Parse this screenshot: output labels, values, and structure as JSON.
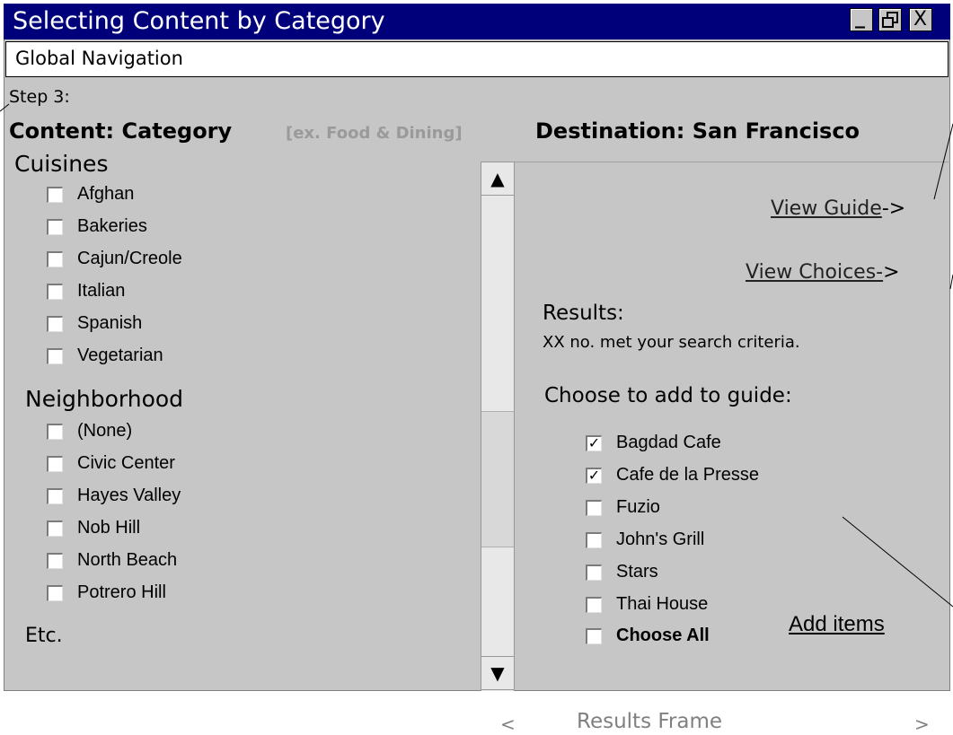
{
  "window": {
    "title": "Selecting Content by Category",
    "controls": {
      "minimize": "_",
      "restore": "❐",
      "close": "X"
    }
  },
  "global_nav": "Global Navigation",
  "step": "Step 3:",
  "content_category": {
    "label": "Content: Category",
    "example": "[ex. Food & Dining]"
  },
  "destination": "Destination: San Francisco",
  "left_panel": {
    "cuisines_heading": "Cuisines",
    "cuisines": [
      "Afghan",
      "Bakeries",
      "Cajun/Creole",
      "Italian",
      "Spanish",
      "Vegetarian"
    ],
    "neighborhood_heading": "Neighborhood",
    "neighborhoods": [
      "(None)",
      "Civic Center",
      "Hayes Valley",
      "Nob Hill",
      "North Beach",
      "Potrero Hill"
    ],
    "etc": "Etc."
  },
  "scrollbar": {
    "up": "▲",
    "down": "▼"
  },
  "results": {
    "view_guide_link": "View Guide",
    "view_guide_arrow": "->",
    "view_choices_link": "View Choices-",
    "view_choices_arrow": ">",
    "heading": "Results:",
    "summary": "XX no. met your search criteria.",
    "choose_heading": "Choose to add to guide:",
    "items": [
      {
        "label": "Bagdad Cafe",
        "checked": true
      },
      {
        "label": "Cafe de la Presse",
        "checked": true
      },
      {
        "label": "Fuzio",
        "checked": false
      },
      {
        "label": "John's Grill",
        "checked": false
      },
      {
        "label": "Stars",
        "checked": false
      },
      {
        "label": "Thai House",
        "checked": false
      }
    ],
    "choose_all": "Choose All",
    "add_items_link": "Add items"
  },
  "checkmark": "✓",
  "footer": {
    "prev": "<",
    "label": "Results Frame",
    "next": ">"
  },
  "colors": {
    "title_bar": "#00007b",
    "window_bg": "#c6c6c6",
    "muted_text": "#9a9a9a"
  }
}
